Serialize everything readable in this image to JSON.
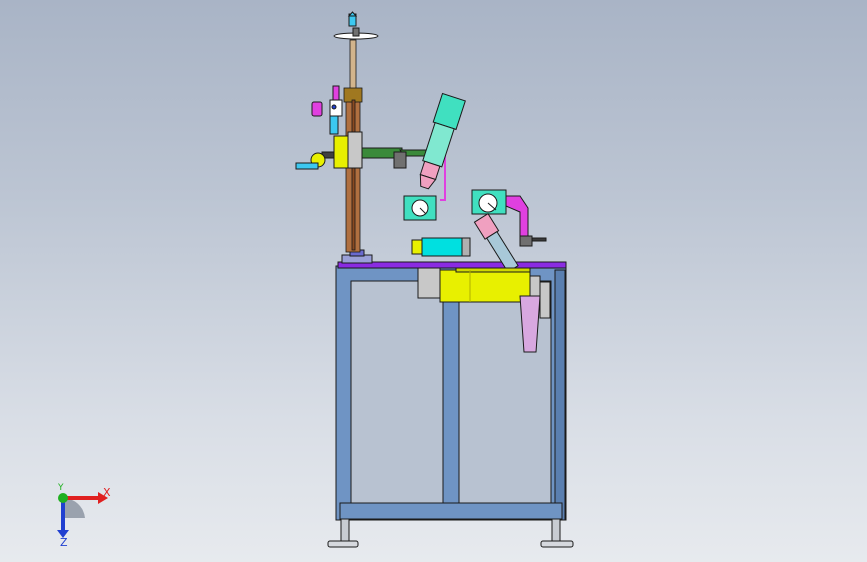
{
  "viewport": {
    "background_top": "#a9b4c6",
    "background_bottom": "#e7eaee"
  },
  "triad": {
    "x_label": "X",
    "y_label": "Y",
    "z_label": "Z",
    "x_color": "#e02020",
    "y_color": "#20b020",
    "z_color": "#2040d0"
  },
  "model": {
    "frame_color": "#6f94c4",
    "frame_edge": "#1a1a1a",
    "table_top_color": "#8a2be2",
    "motor_color": "#e8f000",
    "cylinder_color": "#00e0e0",
    "fixture_color": "#40e0c0",
    "nozzle_color": "#f0a0c0",
    "mount_color": "#e040e0",
    "column_color": "#b07040",
    "handwheel_color": "#3090ff"
  }
}
